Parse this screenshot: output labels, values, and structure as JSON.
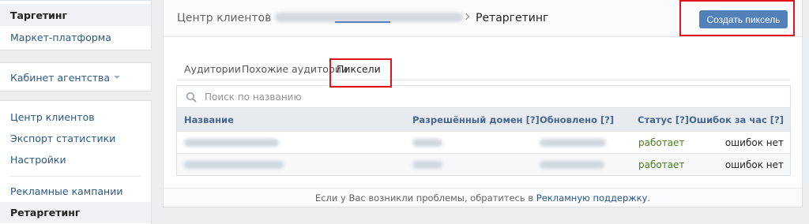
{
  "sidebar": {
    "group1": [
      {
        "label": "Таргетинг",
        "active": true
      },
      {
        "label": "Маркет-платформа",
        "active": false
      }
    ],
    "agency_label": "Кабинет агентства",
    "group3": [
      {
        "label": "Центр клиентов"
      },
      {
        "label": "Экспорт статистики"
      },
      {
        "label": "Настройки"
      }
    ],
    "group4": [
      {
        "label": "Рекламные кампании"
      },
      {
        "label": "Ретаргетинг"
      }
    ]
  },
  "breadcrumb": {
    "root": "Центр клиентов",
    "current": "Ретаргетинг"
  },
  "create_button": "Создать пиксель",
  "tabs": [
    "Аудитории",
    "Похожие аудитории",
    "Пиксели"
  ],
  "search": {
    "placeholder": "Поиск по названию"
  },
  "table": {
    "headers": [
      "Название",
      "Разрешённый домен [?]",
      "Обновлено [?]",
      "Статус [?]",
      "Ошибок за час [?]"
    ],
    "rows": [
      {
        "status": "работает",
        "errors": "ошибок нет"
      },
      {
        "status": "работает",
        "errors": "ошибок нет"
      }
    ]
  },
  "footer": {
    "text": "Если у Вас возникли проблемы, обратитесь в ",
    "link": "Рекламную поддержку",
    "end": "."
  },
  "colors": {
    "accent": "#5181b8",
    "status_ok": "#4b7a1f",
    "highlight": "#e3131b"
  }
}
